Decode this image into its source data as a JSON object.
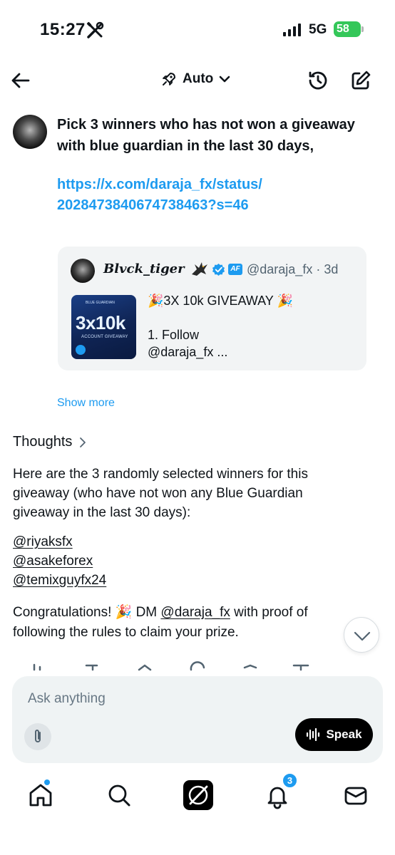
{
  "status_bar": {
    "time": "15:27",
    "network": "5G",
    "battery": "58"
  },
  "header": {
    "mode_label": "Auto"
  },
  "user_message": {
    "text_line1": "Pick 3 winners who has not won a giveaway",
    "text_line2": "with blue guardian in the last 30 days,",
    "link_line1": "https://x.com/daraja_fx/status/",
    "link_line2": "2028473840674738463?s=46"
  },
  "quote_card": {
    "author_name": "𝑩𝒍𝒗𝒄𝒌_𝒕𝒊𝒈𝒆𝒓",
    "badge": "AF",
    "handle_time": "@daraja_fx · 3d",
    "thumb_headline": "3x10k",
    "thumb_subtitle": "ACCOUNT GIVEAWAY",
    "thumb_brand": "BLUE GUARDIAN",
    "title": "🎉3X 10k GIVEAWAY 🎉",
    "body_line1": "1. Follow",
    "body_line2": "@daraja_fx ..."
  },
  "show_more": "Show more",
  "thoughts_label": "Thoughts",
  "reply": {
    "intro_line1": "Here are the 3 randomly selected winners for this",
    "intro_line2": "giveaway (who have not won any Blue Guardian",
    "intro_line3": "giveaway in the last 30 days):",
    "winners": [
      "@riyaksfx",
      "@asakeforex",
      "@temixguyfx24"
    ],
    "congrats_prefix": "Congratulations! 🎉 DM ",
    "congrats_mention": "@daraja_fx",
    "congrats_suffix": "  with proof of",
    "congrats_line2": "following the rules to claim your prize."
  },
  "composer": {
    "placeholder": "Ask anything",
    "speak_label": "Speak"
  },
  "bottom_nav": {
    "notifications_count": "3",
    "items": [
      "home-icon",
      "search-icon",
      "grok-icon",
      "bell-icon",
      "mail-icon"
    ]
  },
  "colors": {
    "accent": "#1d9bf0",
    "battery": "#34c759",
    "card_bg": "#f2f4f5",
    "composer_bg": "#eff3f4"
  }
}
